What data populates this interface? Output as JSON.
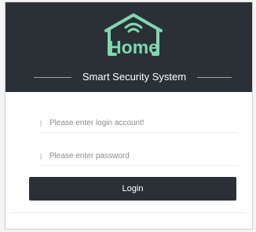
{
  "header": {
    "logo_text": "Home",
    "logo_icon": "wifi-house-icon",
    "title": "Smart Security System"
  },
  "form": {
    "account_placeholder": "Please enter login account!",
    "account_value": "",
    "password_placeholder": "Please enter password",
    "password_value": "",
    "login_label": "Login"
  },
  "colors": {
    "header_bg": "#2b3037",
    "logo_green": "#7fd8b0",
    "button_bg": "#2b3037",
    "button_text": "#ffffff"
  }
}
